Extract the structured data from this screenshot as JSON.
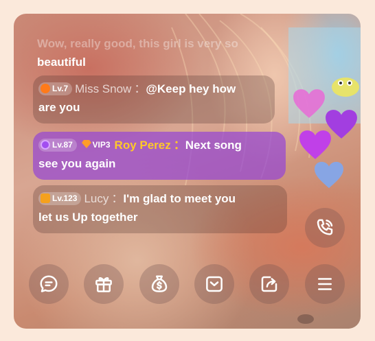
{
  "chat": {
    "previous_message": {
      "line1": "Wow, really good, this girl is very so",
      "line2": "beautiful"
    },
    "messages": [
      {
        "level": "Lv.7",
        "name": "Miss Snow",
        "separator": "：",
        "line1": "@Keep hey how",
        "line2": "are you",
        "level_color": "#ff7a1a"
      },
      {
        "level": "Lv.87",
        "vip_label": "VIP3",
        "name": "Roy Perez",
        "separator": "：",
        "line1": "Next song",
        "line2": "see you again",
        "level_color": "#a24ef0"
      },
      {
        "level": "Lv.123",
        "name": "Lucy",
        "separator": "：",
        "line1": "I'm glad to meet you",
        "line2": "let us Up together",
        "level_color": "#f5a11d"
      }
    ]
  },
  "toolbar": {
    "icons": [
      "chat-bubble-icon",
      "gift-icon",
      "money-bag-icon",
      "message-box-icon",
      "share-icon",
      "menu-icon"
    ]
  },
  "call": {
    "icon": "phone-call-icon"
  },
  "colors": {
    "page_background": "#fbe9db",
    "vip_bubble": "#9646d2",
    "vip_name": "#ffc928",
    "hearts": [
      "#e86ad6",
      "#a23ee0",
      "#c040e8",
      "#7fa7ef"
    ]
  }
}
